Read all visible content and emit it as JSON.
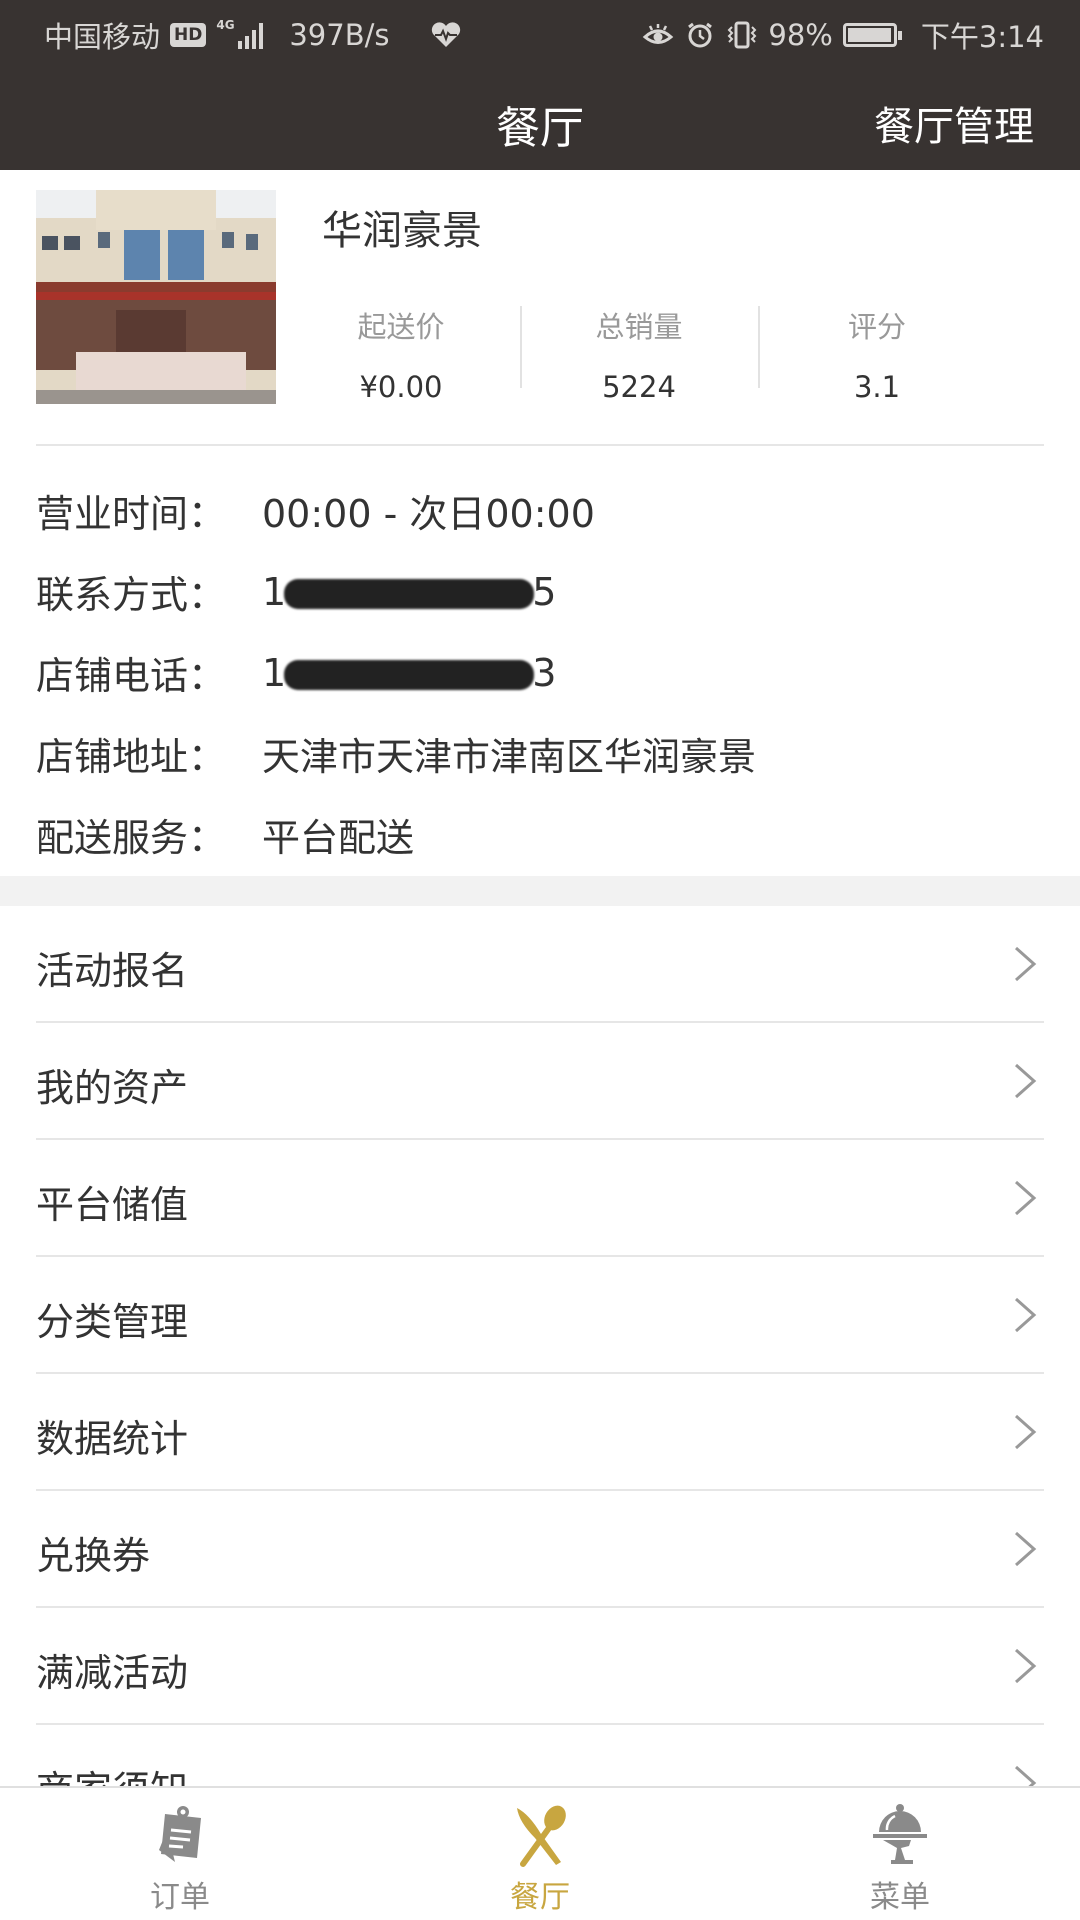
{
  "status_bar": {
    "carrier": "中国移动",
    "hd_badge": "HD",
    "network_type": "4G",
    "net_speed": "397B/s",
    "battery_percent": "98%",
    "battery_level": 0.98,
    "time": "下午3:14",
    "icons": [
      "hd-icon",
      "signal-icon",
      "heart-rate-icon",
      "eye-icon",
      "alarm-icon",
      "vibrate-icon",
      "battery-icon"
    ]
  },
  "header": {
    "title": "餐厅",
    "action_label": "餐厅管理"
  },
  "shop": {
    "name": "华润豪景",
    "photo": "storefront-photo",
    "stats": [
      {
        "label": "起送价",
        "value": "¥0.00"
      },
      {
        "label": "总销量",
        "value": "5224"
      },
      {
        "label": "评分",
        "value": "3.1"
      }
    ],
    "info": [
      {
        "key": "营业时间：",
        "value": "00:00 - 次日00:00"
      },
      {
        "key": "联系方式：",
        "value_prefix": "1",
        "value_suffix": "5",
        "redacted": true
      },
      {
        "key": "店铺电话：",
        "value_prefix": "1",
        "value_suffix": "3",
        "redacted": true
      },
      {
        "key": "店铺地址：",
        "value": "天津市天津市津南区华润豪景"
      },
      {
        "key": "配送服务：",
        "value": "平台配送"
      }
    ]
  },
  "menu": {
    "items": [
      {
        "label": "活动报名"
      },
      {
        "label": "我的资产"
      },
      {
        "label": "平台储值"
      },
      {
        "label": "分类管理"
      },
      {
        "label": "数据统计"
      },
      {
        "label": "兑换券"
      },
      {
        "label": "满减活动"
      },
      {
        "label": "商家须知"
      }
    ]
  },
  "tabbar": {
    "tabs": [
      {
        "label": "订单",
        "icon": "order-clipboard-icon",
        "active": false
      },
      {
        "label": "餐厅",
        "icon": "knife-spoon-icon",
        "active": true
      },
      {
        "label": "菜单",
        "icon": "cloche-icon",
        "active": false
      }
    ],
    "active_color": "#c8a640",
    "inactive_color": "#8a8a8a"
  },
  "colors": {
    "header_bg": "#383331",
    "accent": "#c8a640"
  }
}
